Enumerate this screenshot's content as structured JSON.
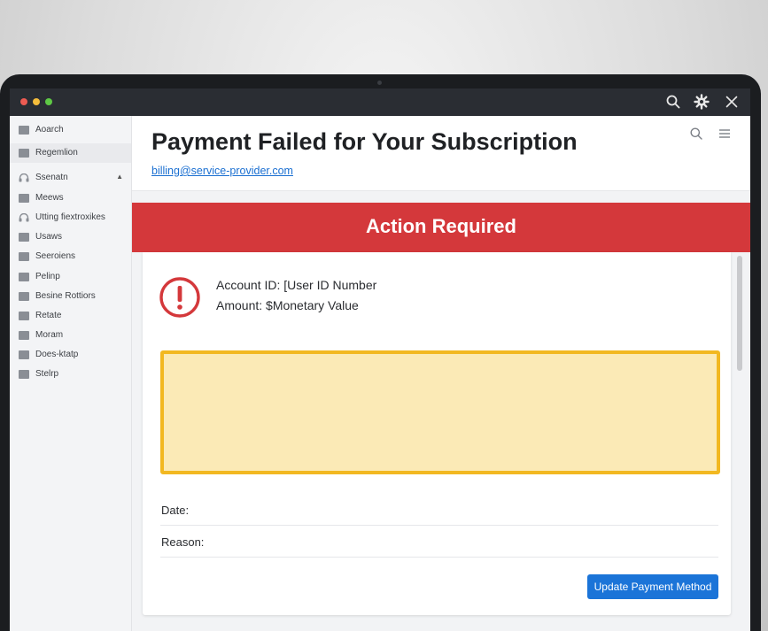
{
  "window": {
    "controls": [
      "close",
      "minimize",
      "maximize"
    ],
    "toolbar_icons": [
      "search-icon",
      "gear-icon",
      "close-icon"
    ]
  },
  "sidebar": {
    "items": [
      {
        "label": "Aoarch",
        "icon": "folder-icon"
      },
      {
        "label": "Regemlion",
        "icon": "folder-icon",
        "active": true
      },
      {
        "label": "Ssenatn",
        "icon": "headset-icon",
        "expanded": true
      },
      {
        "label": "Meews",
        "icon": "folder-icon"
      },
      {
        "label": "Utting fiextroxikes",
        "icon": "headset-icon"
      },
      {
        "label": "Usaws",
        "icon": "folder-icon"
      },
      {
        "label": "Seeroiens",
        "icon": "folder-icon"
      },
      {
        "label": "Pelinp",
        "icon": "folder-icon"
      },
      {
        "label": "Besine Rottiors",
        "icon": "folder-icon"
      },
      {
        "label": "Retate",
        "icon": "folder-icon"
      },
      {
        "label": "Moram",
        "icon": "folder-icon"
      },
      {
        "label": "Does-ktatp",
        "icon": "folder-icon"
      },
      {
        "label": "Stelrp",
        "icon": "folder-icon"
      }
    ]
  },
  "email": {
    "subject": "Payment Failed for Your Subscription",
    "sender": "billing@service-provider.com",
    "header_icons": [
      "search-icon",
      "menu-icon"
    ],
    "banner": "Action Required",
    "account_line": "Account ID: [User ID Number",
    "amount_line": "Amount: $Monetary Value",
    "date_label": "Date:",
    "reason_label": "Reason:",
    "button_label": "Update Payment Method"
  },
  "colors": {
    "banner": "#d4383b",
    "alert_icon": "#d4383b",
    "warning_fill": "#fbeab6",
    "warning_border": "#f2b821",
    "button": "#1b74d8",
    "link": "#1a6fd1"
  }
}
